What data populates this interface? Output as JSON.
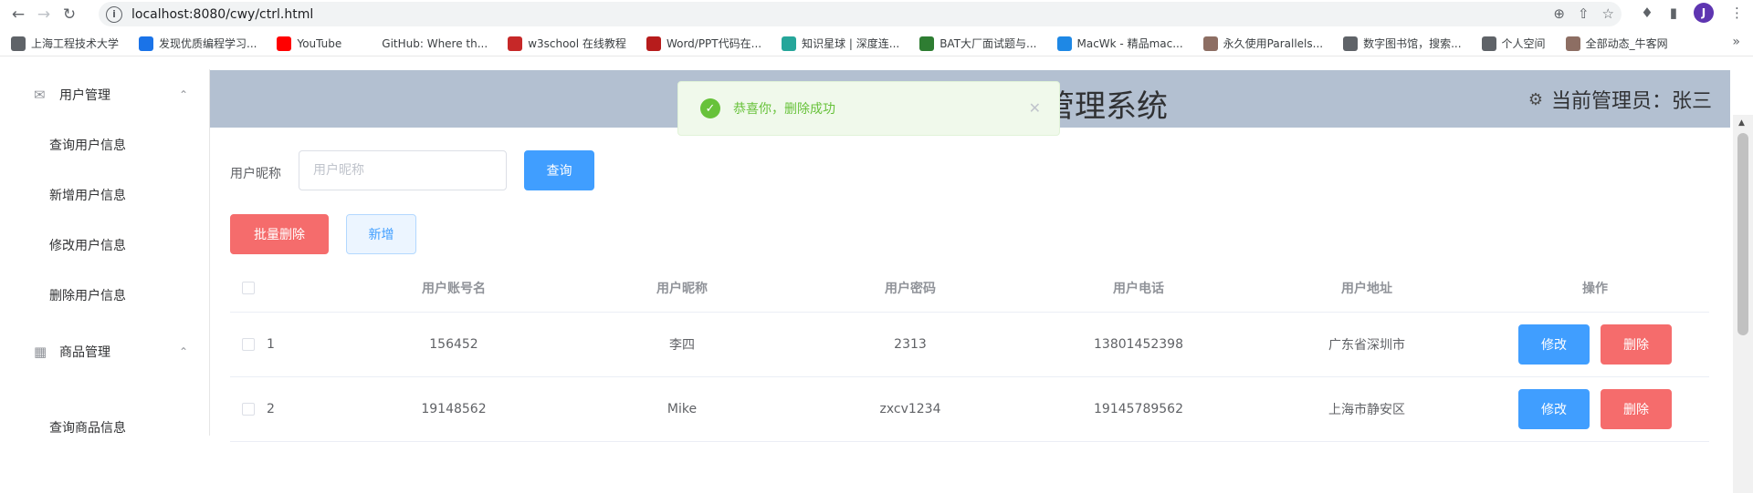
{
  "browser": {
    "url": "localhost:8080/cwy/ctrl.html",
    "avatar_letter": "J",
    "bookmarks": [
      {
        "label": "上海工程技术大学",
        "color": "#5f6368"
      },
      {
        "label": "发现优质编程学习...",
        "color": "#1a73e8"
      },
      {
        "label": "YouTube",
        "color": "#ff0000"
      },
      {
        "label": "GitHub: Where th...",
        "color": "#ffffff"
      },
      {
        "label": "w3school 在线教程",
        "color": "#c62828"
      },
      {
        "label": "Word/PPT代码在...",
        "color": "#b71c1c"
      },
      {
        "label": "知识星球 | 深度连...",
        "color": "#26a69a"
      },
      {
        "label": "BAT大厂面试题与...",
        "color": "#2e7d32"
      },
      {
        "label": "MacWk - 精品mac...",
        "color": "#1e88e5"
      },
      {
        "label": "永久使用Parallels...",
        "color": "#8d6e63"
      },
      {
        "label": "数字图书馆，搜索...",
        "color": "#5f6368"
      },
      {
        "label": "个人空间",
        "color": "#5f6368"
      },
      {
        "label": "全部动态_牛客网",
        "color": "#8d6e63"
      }
    ]
  },
  "sidebar": {
    "user_group": "用户管理",
    "user_items": [
      "查询用户信息",
      "新增用户信息",
      "修改用户信息",
      "删除用户信息"
    ],
    "goods_group": "商品管理",
    "goods_items": [
      "查询商品信息"
    ]
  },
  "header": {
    "title": "件销售管理系统",
    "admin": "当前管理员：张三"
  },
  "toast": {
    "message": "恭喜你，删除成功"
  },
  "search": {
    "label": "用户昵称",
    "placeholder": "用户昵称",
    "button": "查询"
  },
  "actions": {
    "batch_delete": "批量删除",
    "add": "新增"
  },
  "table": {
    "columns": [
      "用户账号名",
      "用户昵称",
      "用户密码",
      "用户电话",
      "用户地址",
      "操作"
    ],
    "edit_label": "修改",
    "delete_label": "删除",
    "rows": [
      {
        "index": "1",
        "account": "156452",
        "nickname": "李四",
        "password": "2313",
        "phone": "13801452398",
        "address": "广东省深圳市"
      },
      {
        "index": "2",
        "account": "19148562",
        "nickname": "Mike",
        "password": "zxcv1234",
        "phone": "19145789562",
        "address": "上海市静安区"
      }
    ]
  },
  "colors": {
    "primary": "#409eff",
    "danger": "#f56c6c",
    "success": "#67c23a",
    "header_bg": "#b3c0d1"
  }
}
